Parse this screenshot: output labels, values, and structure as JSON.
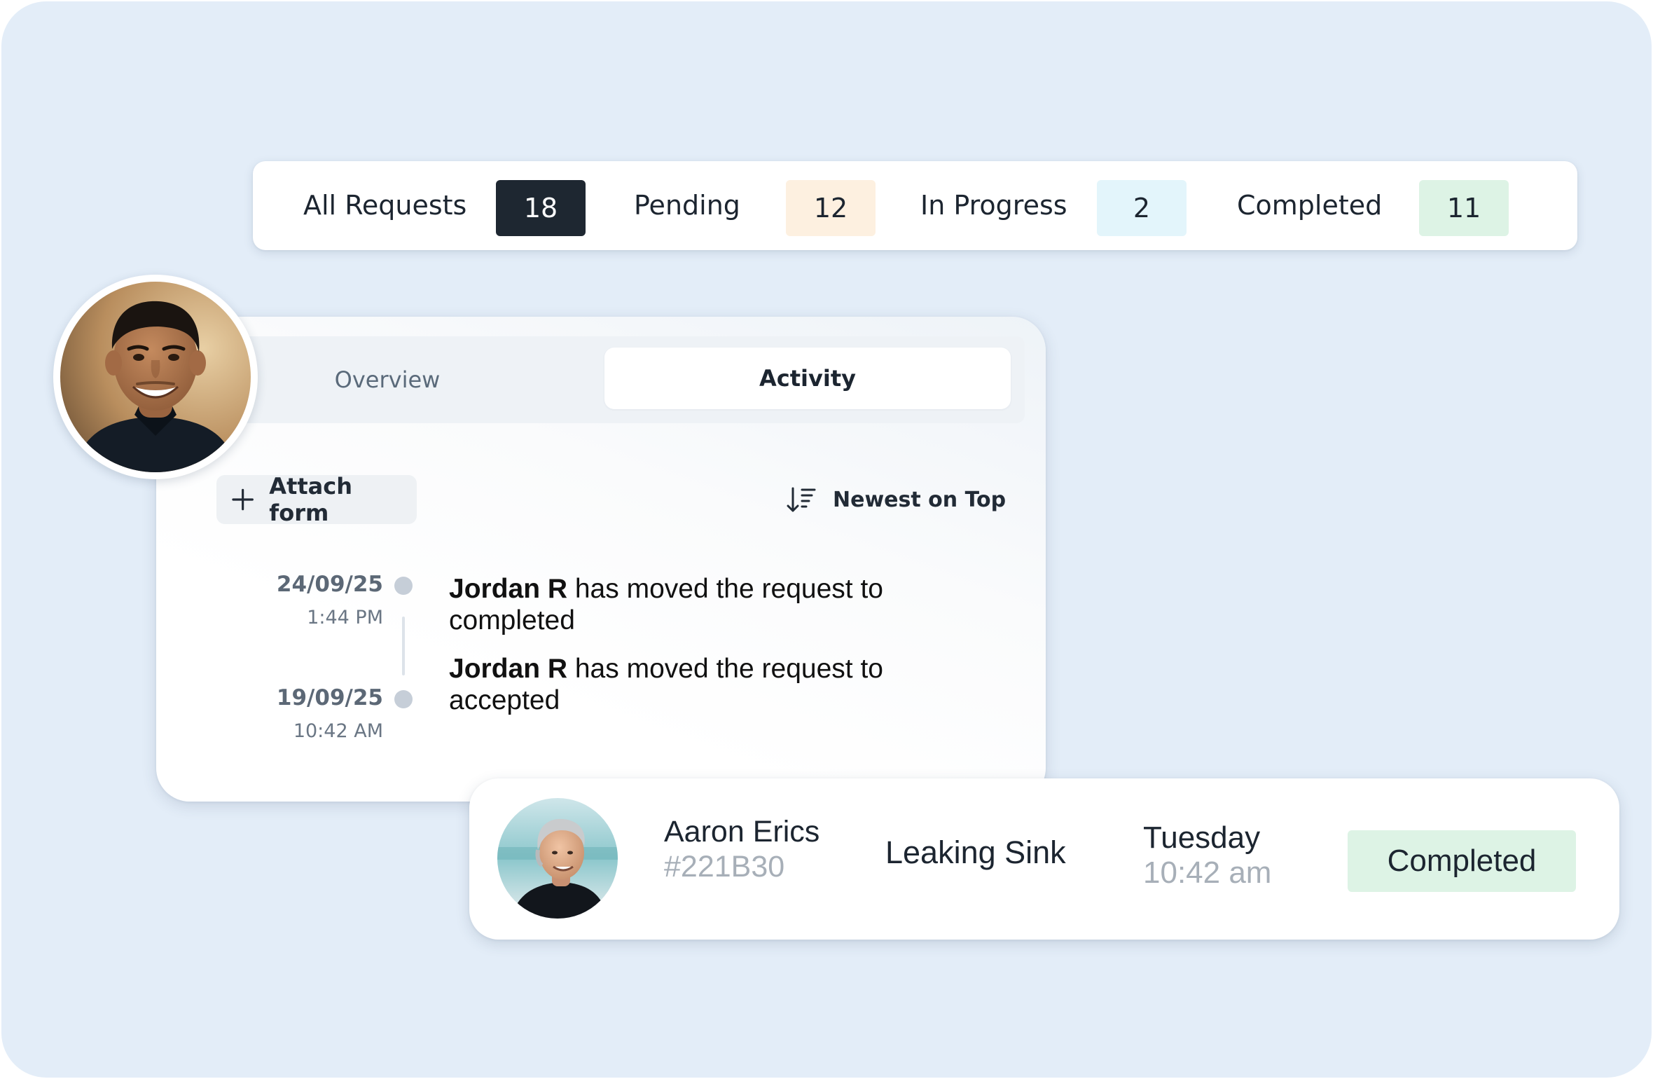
{
  "status_bar": {
    "all": {
      "label": "All Requests",
      "count": "18"
    },
    "pending": {
      "label": "Pending",
      "count": "12"
    },
    "in_progress": {
      "label": "In Progress",
      "count": "2"
    },
    "completed": {
      "label": "Completed",
      "count": "11"
    }
  },
  "activity": {
    "tabs": {
      "overview": "Overview",
      "activity": "Activity",
      "selected": "Activity"
    },
    "attach_label": "Attach form",
    "sort_label": "Newest on Top",
    "entries": [
      {
        "date": "24/09/25",
        "time": "1:44 PM",
        "actor": "Jordan R",
        "text": " has moved the request to completed"
      },
      {
        "date": "19/09/25",
        "time": "10:42 AM",
        "actor": "Jordan R",
        "text": " has moved the request to accepted"
      }
    ]
  },
  "request": {
    "name": "Aaron Erics",
    "id": "#221B30",
    "title": "Leaking Sink",
    "day": "Tuesday",
    "time": "10:42 am",
    "status": "Completed"
  },
  "colors": {
    "background": "#e3edf8",
    "count_dark": "#1e2731",
    "pending": "#fdf0e0",
    "in_progress": "#e3f5fb",
    "completed": "#ddf3e5"
  },
  "icons": {
    "attach": "plus-icon",
    "sort": "sort-descending-icon"
  }
}
